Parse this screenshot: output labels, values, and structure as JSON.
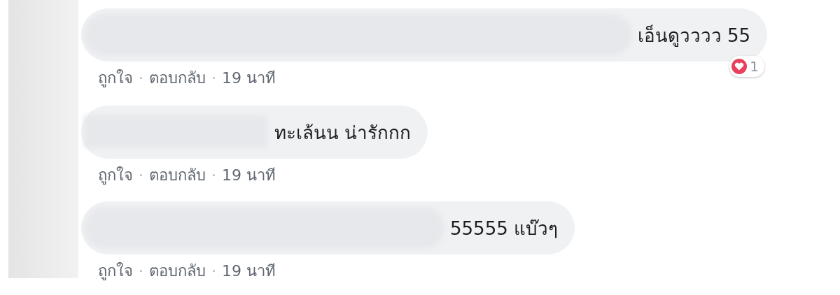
{
  "comments": [
    {
      "name_blurred": true,
      "text": "เอ็นดูวววว 55",
      "reaction": {
        "count": "1"
      },
      "actions": [
        {
          "label": "ถูกใจ"
        },
        {
          "label": "ตอบกลับ"
        }
      ],
      "separator": "·",
      "time": "19 นาที"
    },
    {
      "name_blurred": true,
      "text": "ทะเล้นน น่ารักกก",
      "actions": [
        {
          "label": "ถูกใจ"
        },
        {
          "label": "ตอบกลับ"
        }
      ],
      "separator": "·",
      "time": "19 นาที"
    },
    {
      "name_blurred": true,
      "text": "55555 แบ๊วๆ",
      "actions": [
        {
          "label": "ถูกใจ"
        },
        {
          "label": "ตอบกลับ"
        }
      ],
      "separator": "·",
      "time": "19 นาที"
    }
  ]
}
